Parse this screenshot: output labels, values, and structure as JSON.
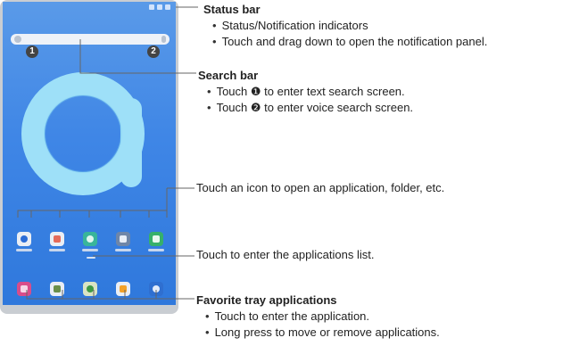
{
  "status_bar": {
    "title": "Status bar",
    "bullets": [
      "Status/Notification indicators",
      "Touch and drag down to open the notification panel."
    ]
  },
  "search_bar": {
    "title": "Search bar",
    "bullets": [
      "Touch ❶ to enter text search screen.",
      "Touch ❷ to enter voice search screen."
    ]
  },
  "callouts": {
    "one": "1",
    "two": "2"
  },
  "icon_note": "Touch an icon to open an application, folder, etc.",
  "app_list_note": "Touch to enter the applications list.",
  "favorite_tray": {
    "title": "Favorite tray applications",
    "bullets": [
      "Touch to enter the application.",
      "Long press to move or remove applications."
    ]
  },
  "colors": {
    "screen_blue": "#3f86e6",
    "brand_a": "#8fd6f5"
  },
  "home_apps": [
    "clock-app-icon",
    "photos-app-icon",
    "music-app-icon",
    "settings-app-icon",
    "play-store-icon"
  ],
  "tray_apps": [
    "gallery-app-icon",
    "files-app-icon",
    "chrome-app-icon",
    "notes-app-icon",
    "contacts-app-icon"
  ]
}
